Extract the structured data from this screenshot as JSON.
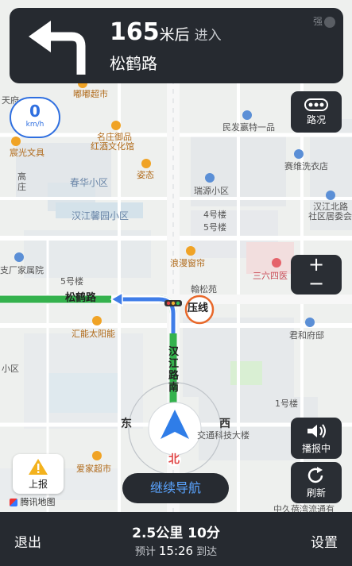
{
  "banner": {
    "distance": "165",
    "unit": "米后",
    "action": "进入",
    "road": "松鹤路",
    "signal": "强"
  },
  "speed": {
    "value": "0",
    "unit": "km/h"
  },
  "buttons": {
    "traffic": "路况",
    "zoom_in": "+",
    "zoom_out": "−",
    "broadcast": "播报中",
    "refresh": "刷新",
    "report": "上报",
    "continue": "继续导航"
  },
  "brand": "腾讯地图",
  "bottom": {
    "exit": "退出",
    "summary": "2.5公里 10分",
    "eta_prefix": "预计",
    "eta_time": "15:26",
    "eta_suffix": "到达",
    "settings": "设置"
  },
  "map": {
    "labels": [
      "嘟嘟超市",
      "天府",
      "民发嬴特一品",
      "名庄御品",
      "红酒文化馆",
      "宸光文具",
      "赛维洗衣店",
      "春华小区",
      "姿态",
      "瑞源小区",
      "汉江馨园小区",
      "汉江北路",
      "社区居委会",
      "4号楼",
      "5号楼",
      "高庄",
      "支厂家属院",
      "浪漫窗帘",
      "翰松苑",
      "三六四医",
      "5号楼",
      "松鹤路",
      "压线",
      "汇能太阳能",
      "君和府邸",
      "汉江路南",
      "小区",
      "1号楼",
      "交通科技大楼",
      "爱家超市",
      "中久蓓湾流通有",
      "东",
      "西",
      "北"
    ]
  },
  "colors": {
    "route": "#34b24d",
    "upcoming": "#3f7de8",
    "banner": "#262a30"
  }
}
